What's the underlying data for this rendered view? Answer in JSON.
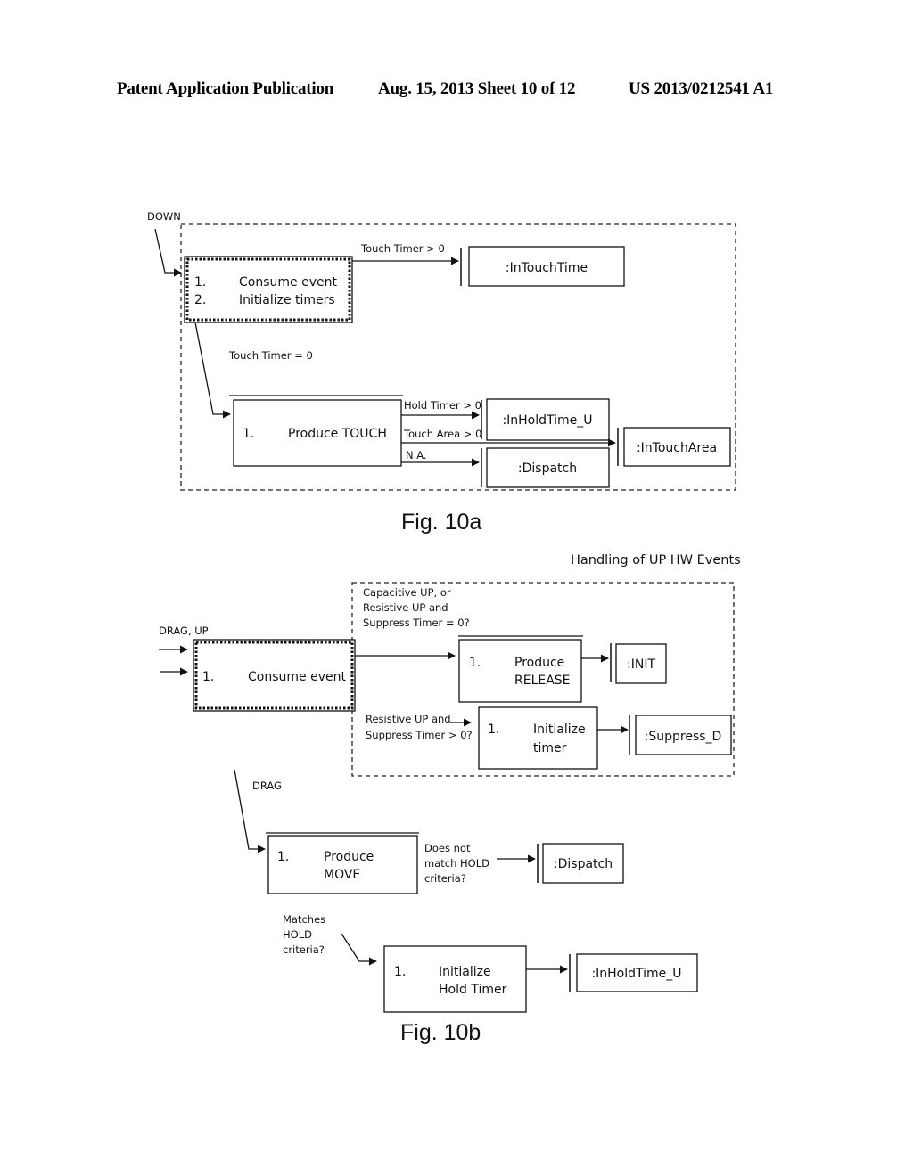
{
  "header": {
    "left": "Patent Application Publication",
    "date_sheet": "Aug. 15, 2013   Sheet 10 of 12",
    "number": "US 2013/0212541 A1"
  },
  "fig10a": {
    "caption": "Fig. 10a",
    "entry_label": "DOWN",
    "consume_box": {
      "lines": [
        {
          "num": "1.",
          "text": "Consume event"
        },
        {
          "num": "2.",
          "text": "Initialize timers"
        }
      ]
    },
    "edge_touch_timer_gt0": "Touch Timer  > 0",
    "edge_touch_timer_eq0": "Touch Timer  = 0",
    "state_in_touch_time": ":InTouchTime",
    "produce_touch_box": {
      "num": "1.",
      "text": "Produce TOUCH"
    },
    "edge_hold_timer_gt0": "Hold Timer  > 0",
    "edge_touch_area_gt0": "Touch Area > 0",
    "edge_na": "N.A.",
    "state_in_hold_time_u": ":InHoldTime_U",
    "state_in_touch_area": ":InTouchArea",
    "state_dispatch": ":Dispatch"
  },
  "fig10b": {
    "caption": "Fig. 10b",
    "title": "Handling of UP HW Events",
    "entry_label": "DRAG, UP",
    "consume_box": {
      "num": "1.",
      "text": "Consume event"
    },
    "cond_release": [
      "Capacitive UP, or",
      "Resistive UP  and",
      "Suppress Timer = 0?"
    ],
    "release_box": {
      "num": "1.",
      "lines": [
        "Produce",
        "RELEASE"
      ]
    },
    "state_init": ":INIT",
    "cond_suppress": [
      "Resistive UP  and",
      "Suppress Timer > 0?"
    ],
    "init_timer_box": {
      "num": "1.",
      "lines": [
        "Initialize",
        "timer"
      ]
    },
    "state_suppress_d": ":Suppress_D",
    "drag_label": "DRAG",
    "move_box": {
      "num": "1.",
      "lines": [
        "Produce",
        "MOVE"
      ]
    },
    "cond_no_hold": [
      "Does not",
      "match HOLD",
      "criteria?"
    ],
    "state_dispatch": ":Dispatch",
    "cond_hold": [
      "Matches",
      "HOLD",
      "criteria?"
    ],
    "hold_timer_box": {
      "num": "1.",
      "lines": [
        "Initialize",
        "Hold Timer"
      ]
    },
    "state_in_hold_time_u": ":InHoldTime_U"
  }
}
